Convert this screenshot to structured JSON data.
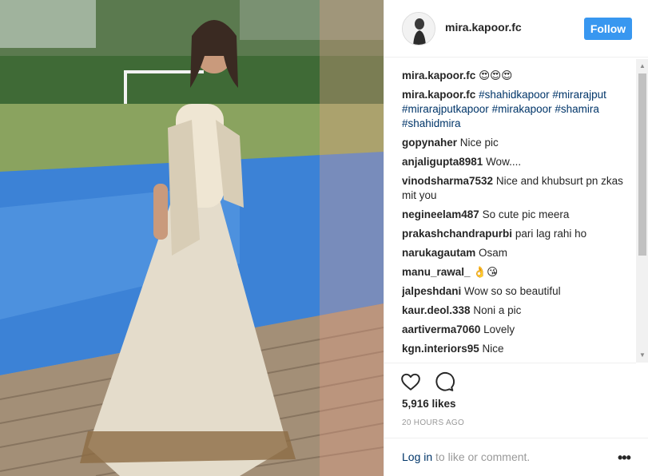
{
  "post": {
    "author": "mira.kapoor.fc",
    "follow_label": "Follow"
  },
  "caption": {
    "user": "mira.kapoor.fc",
    "emoji": "😍😍😍"
  },
  "hashtag_comment": {
    "user": "mira.kapoor.fc",
    "tags": [
      "#shahidkapoor",
      "#mirarajput",
      "#mirarajputkapoor",
      "#mirakapoor",
      "#shamira",
      "#shahidmira"
    ]
  },
  "comments": [
    {
      "user": "gopynaher",
      "text": "Nice pic"
    },
    {
      "user": "anjaligupta8981",
      "text": "Wow...."
    },
    {
      "user": "vinodsharma7532",
      "text": "Nice and khubsurt pn zkas mit you"
    },
    {
      "user": "negineelam487",
      "text": "So cute pic meera"
    },
    {
      "user": "prakashchandrapurbi",
      "text": "pari lag rahi ho"
    },
    {
      "user": "narukagautam",
      "text": "Osam"
    },
    {
      "user": "manu_rawal_",
      "text": "👌😘"
    },
    {
      "user": "jalpeshdani",
      "text": "Wow so so beautiful"
    },
    {
      "user": "kaur.deol.338",
      "text": "Noni a pic"
    },
    {
      "user": "aartiverma7060",
      "text": "Lovely"
    },
    {
      "user": "kgn.interiors95",
      "text": "Nice"
    }
  ],
  "likes": "5,916 likes",
  "timestamp": "20 HOURS AGO",
  "footer": {
    "login_link": "Log in",
    "login_rest": " to like or comment.",
    "more": "•••"
  },
  "colors": {
    "follow_button": "#3897f0",
    "hashtag": "#003569",
    "muted": "#999999"
  },
  "icons": {
    "like": "heart-outline-icon",
    "comment": "speech-bubble-icon",
    "more": "ellipsis-icon"
  }
}
